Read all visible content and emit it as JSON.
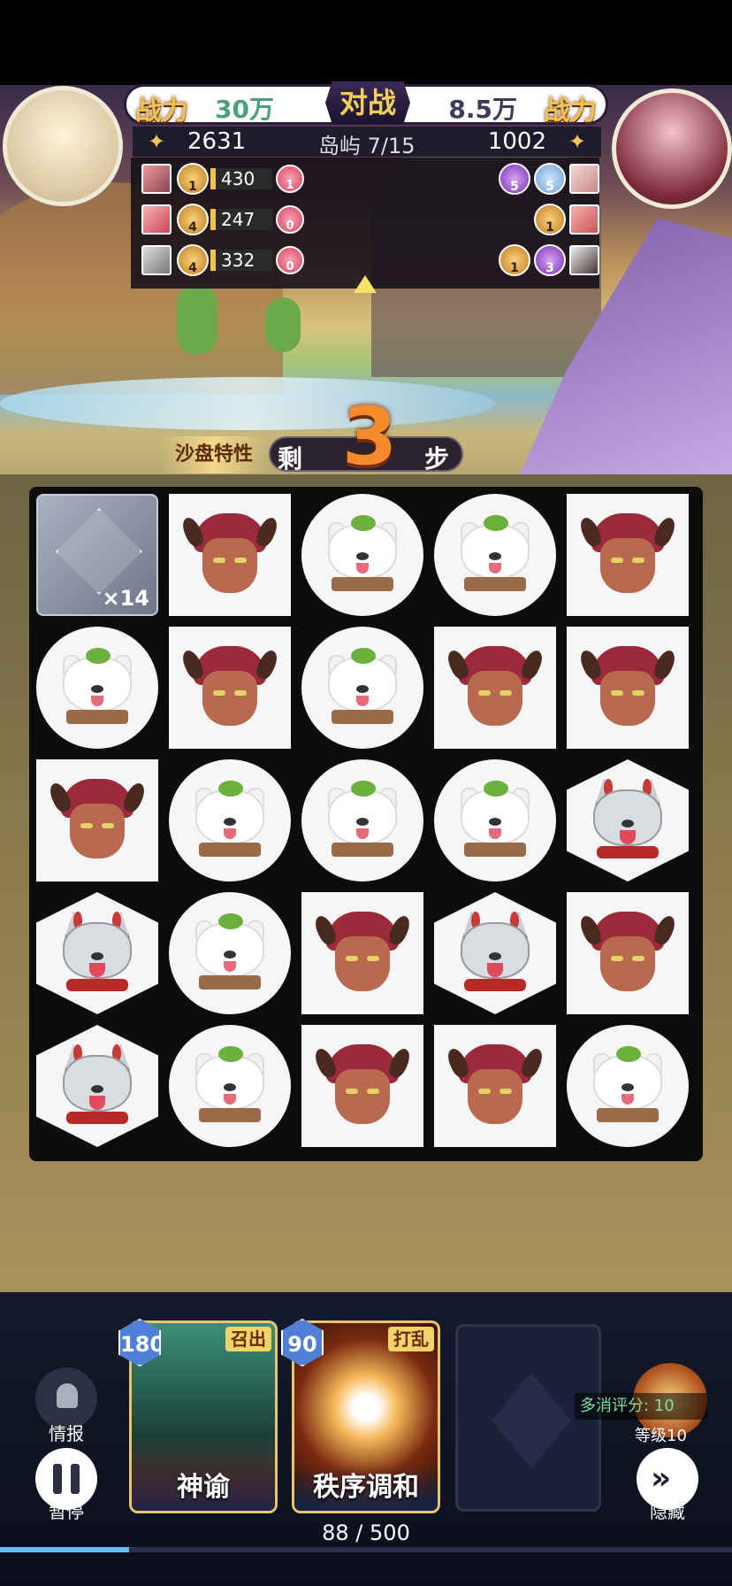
{
  "header": {
    "power_label_left": "战力",
    "power_value_left": "30万",
    "vs_label": "对战",
    "power_value_right": "8.5万",
    "power_label_right": "战力",
    "score_left": "2631",
    "island_label": "岛屿 7/15",
    "score_right": "1002"
  },
  "units": {
    "left": [
      {
        "badge": "1",
        "hp": "430",
        "count": "1"
      },
      {
        "badge": "4",
        "hp": "247",
        "count": "0"
      },
      {
        "badge": "4",
        "hp": "332",
        "count": "0"
      }
    ],
    "right": [
      {
        "badges": [
          "5",
          "5"
        ]
      },
      {
        "badges": [
          "1"
        ]
      },
      {
        "badges": [
          "1",
          "3"
        ]
      }
    ]
  },
  "steps": {
    "trait_label": "沙盘特性",
    "prefix": "剩",
    "count": "3",
    "suffix": "步"
  },
  "board": {
    "stone_count": "×14",
    "rows": [
      [
        "stone",
        "demon",
        "dog",
        "dog",
        "demon"
      ],
      [
        "dog",
        "demon",
        "dog",
        "demon",
        "demon"
      ],
      [
        "demon",
        "dog",
        "dog",
        "dog",
        "wolf"
      ],
      [
        "wolf",
        "dog",
        "demon",
        "wolf",
        "demon"
      ],
      [
        "wolf",
        "dog",
        "demon",
        "demon",
        "dog"
      ]
    ]
  },
  "controls": {
    "info_label": "情报",
    "pause_label": "暂停",
    "hide_label": "隐藏",
    "combo_score": "多消评分: 10",
    "level_label": "等级10"
  },
  "cards": [
    {
      "cost": "180",
      "tag": "召出",
      "name": "神谕"
    },
    {
      "cost": "90",
      "tag": "打乱",
      "name": "秩序调和"
    }
  ],
  "progress": {
    "text": "88 / 500",
    "fraction": 0.176
  },
  "colors": {
    "accent_gold": "#f2c24a",
    "power_left": "#4aa07a",
    "steps_orange": "#f38b2d",
    "progress_blue": "#6cb9f0"
  }
}
